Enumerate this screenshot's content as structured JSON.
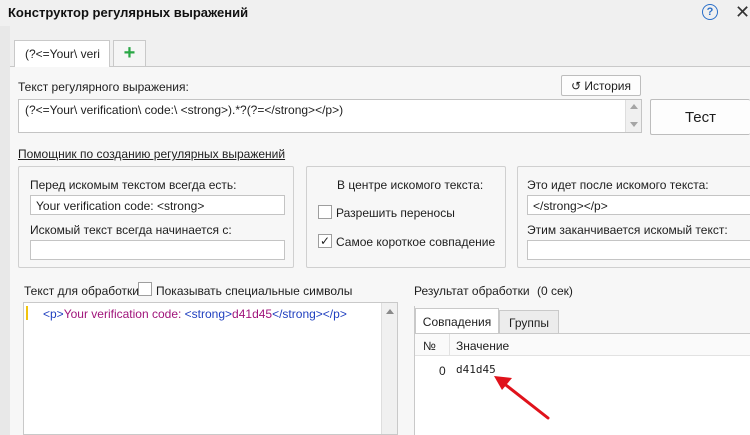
{
  "window": {
    "title": "Конструктор регулярных выражений",
    "help_glyph": "?",
    "close_glyph": "✕"
  },
  "tabs": [
    {
      "label": "(?<=Your\\ veri"
    }
  ],
  "add_tab_glyph": "+",
  "regex": {
    "label": "Текст регулярного выражения:",
    "value": "(?<=Your\\ verification\\ code:\\ <strong>).*?(?=</strong></p>)",
    "history_button": "История",
    "test_button": "Тест"
  },
  "helper_link": "Помощник по созданию регулярных выражений",
  "before_group": {
    "label_before": "Перед искомым текстом всегда есть:",
    "before_value": "Your verification code: <strong>",
    "label_starts": "Искомый текст всегда начинается с:",
    "starts_value": ""
  },
  "center_group": {
    "label": "В центре искомого текста:",
    "allow_breaks": {
      "label": "Разрешить переносы",
      "checked": false
    },
    "shortest": {
      "label": "Самое короткое совпадение",
      "checked": true,
      "glyph": "✓"
    }
  },
  "after_group": {
    "label_after": "Это идет после искомого текста:",
    "after_value": "</strong></p>",
    "label_ends": "Этим заканчивается искомый текст:",
    "ends_value": ""
  },
  "source": {
    "label": "Текст для обработки",
    "show_special_label": "Показывать специальные символы",
    "tokens": [
      {
        "t": "<p>",
        "c": "tag"
      },
      {
        "t": "Your verification code: ",
        "c": "text"
      },
      {
        "t": "<strong>",
        "c": "tag"
      },
      {
        "t": "d41d45",
        "c": "text"
      },
      {
        "t": "</strong>",
        "c": "tag"
      },
      {
        "t": "</p>",
        "c": "tag"
      }
    ]
  },
  "result": {
    "label": "Результат обработки",
    "time": "(0 сек)",
    "tabs": [
      "Совпадения",
      "Группы"
    ],
    "columns": [
      "№",
      "Значение"
    ],
    "rows": [
      {
        "num": "0",
        "value": "d41d45"
      }
    ]
  },
  "colors": {
    "tag": "#1f3fbf",
    "text": "#a0147a",
    "arrow": "#e0121b",
    "plus": "#29a745",
    "accent": "#2a6fc9"
  }
}
